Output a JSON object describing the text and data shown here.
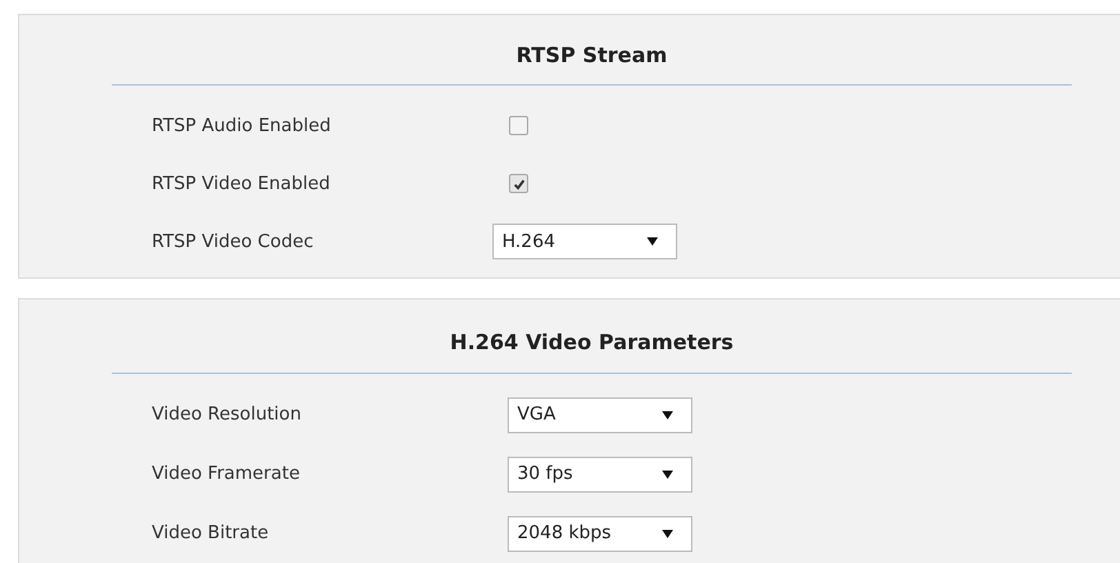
{
  "sections": [
    {
      "title": "RTSP Stream",
      "fields": [
        {
          "kind": "checkbox",
          "label": "RTSP Audio Enabled",
          "checked": false
        },
        {
          "kind": "checkbox",
          "label": "RTSP Video Enabled",
          "checked": true
        },
        {
          "kind": "select",
          "label": "RTSP Video Codec",
          "value": "H.264"
        }
      ]
    },
    {
      "title": "H.264 Video Parameters",
      "fields": [
        {
          "kind": "select",
          "label": "Video Resolution",
          "value": "VGA"
        },
        {
          "kind": "select",
          "label": "Video Framerate",
          "value": "30 fps"
        },
        {
          "kind": "select",
          "label": "Video Bitrate",
          "value": "2048 kbps"
        }
      ]
    }
  ]
}
